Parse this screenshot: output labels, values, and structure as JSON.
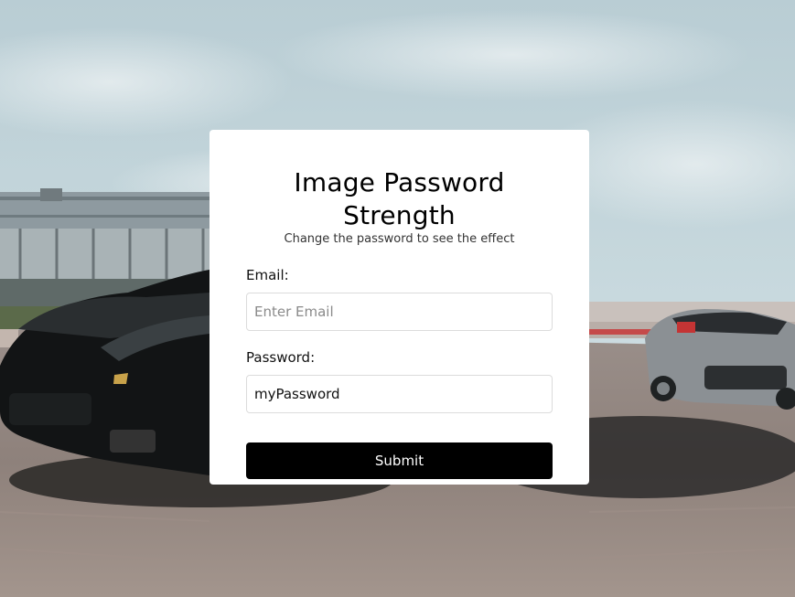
{
  "page": {
    "title": "Image Password Strength",
    "subtitle": "Change the password to see the effect"
  },
  "form": {
    "email_label": "Email:",
    "email_placeholder": "Enter Email",
    "email_value": "",
    "password_label": "Password:",
    "password_value": "myPassword",
    "submit_label": "Submit"
  },
  "colors": {
    "card_bg": "#ffffff",
    "button_bg": "#000000",
    "button_text": "#ffffff",
    "field_border": "#dcdcdc"
  },
  "background": {
    "subject": "race cars on track background photo"
  }
}
